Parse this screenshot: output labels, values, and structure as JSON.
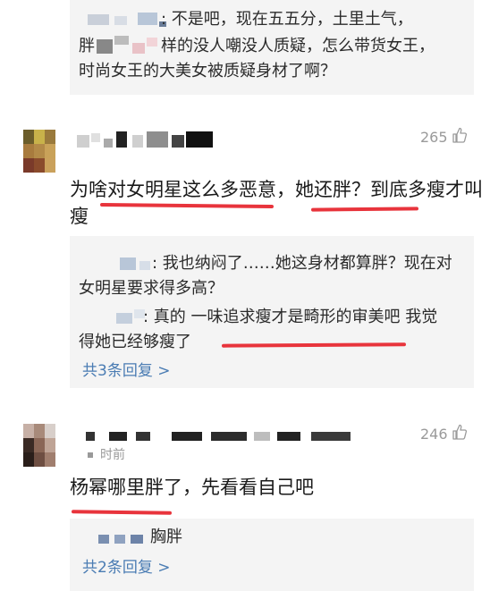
{
  "top_reply": {
    "line1": ": 不是吧，现在五五分，土里土气，",
    "line2_pre": "胖",
    "line2": "样的没人嘲没人质疑，怎么带货女王，",
    "line3": "时尚女王的大美女被质疑身材了啊？"
  },
  "comment1": {
    "likes": "265",
    "text_line1": "为啥对女明星这么多恶意，她还胖？到底多瘦才叫",
    "text_line2": "瘦",
    "replies": [
      {
        "line1": ": 我也纳闷了……她这身材都算胖？现在对",
        "line2": "女明星要求得多高？"
      },
      {
        "line1": ": 真的 一味追求瘦才是畸形的审美吧 我觉",
        "line2": "得她已经够瘦了"
      }
    ],
    "more_replies": "共3条回复 >"
  },
  "comment2": {
    "likes": "246",
    "time_suffix": "时前",
    "text": "杨幂哪里胖了，先看看自己吧",
    "reply_text": "胸胖",
    "more_replies": "共2条回复 >"
  },
  "colors": {
    "accent_link": "#4a7cb3",
    "underline": "#e8343c",
    "reply_bg": "#f4f4f4"
  },
  "icons": [
    "thumbs-up-icon"
  ]
}
